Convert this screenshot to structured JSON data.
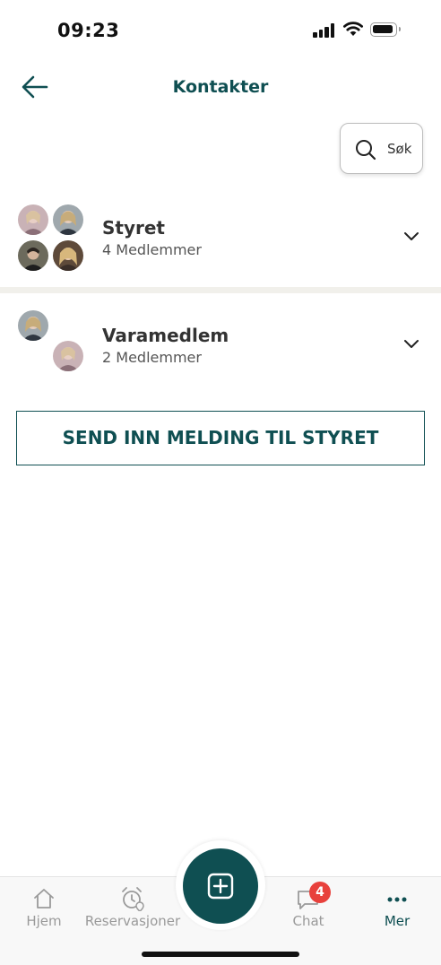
{
  "status_bar": {
    "time": "09:23"
  },
  "header": {
    "title": "Kontakter"
  },
  "search": {
    "label": "Søk"
  },
  "groups": [
    {
      "name": "Styret",
      "members": "4 Medlemmer"
    },
    {
      "name": "Varamedlem",
      "members": "2 Medlemmer"
    }
  ],
  "send_button": {
    "label": "SEND INN MELDING TIL STYRET"
  },
  "bottom_nav": {
    "items": [
      {
        "label": "Hjem",
        "icon": "home-icon"
      },
      {
        "label": "Reservasjoner",
        "icon": "alarm-clock-icon"
      },
      {
        "label": "Chat",
        "icon": "chat-icon",
        "badge": "4"
      },
      {
        "label": "Mer",
        "icon": "more-dots-icon"
      }
    ],
    "active": "Mer"
  },
  "colors": {
    "accent": "#0f4f52",
    "badge": "#e8413c",
    "inactive": "#9a9a9a"
  }
}
